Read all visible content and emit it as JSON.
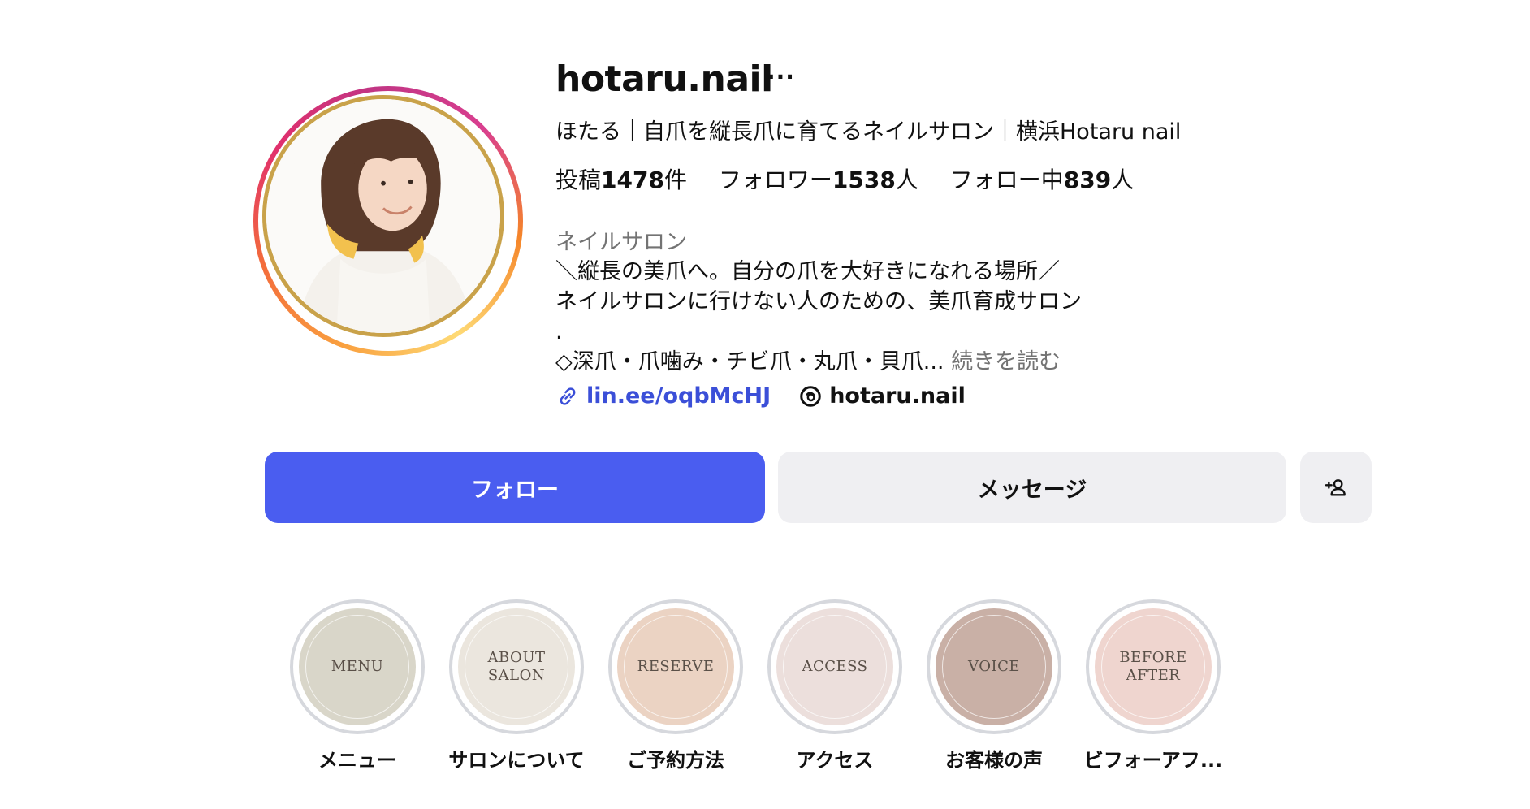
{
  "profile": {
    "username": "hotaru.nail",
    "more_label": "···",
    "full_name": "ほたる｜自爪を縦長爪に育てるネイルサロン｜横浜Hotaru nail",
    "avatar_icon": "profile-photo"
  },
  "stats": {
    "posts_prefix": "投稿",
    "posts_value": "1478",
    "posts_suffix": "件",
    "followers_prefix": "フォロワー",
    "followers_value": "1538",
    "followers_suffix": "人",
    "following_prefix": "フォロー中",
    "following_value": "839",
    "following_suffix": "人"
  },
  "category": "ネイルサロン",
  "bio": {
    "line1": "＼縦長の美爪へ。自分の爪を大好きになれる場所／",
    "line2": "ネイルサロンに行けない人のための、美爪育成サロン",
    "line3": ".",
    "line4": "◇深爪・爪噛み・チビ爪・丸爪・貝爪...",
    "read_more": "続きを読む"
  },
  "links": {
    "url_text": "lin.ee/oqbMcHJ",
    "url_icon": "link-icon",
    "threads_text": "hotaru.nail",
    "threads_icon": "threads-icon"
  },
  "buttons": {
    "follow": "フォロー",
    "message": "メッセージ",
    "add_user_icon": "add-user-icon"
  },
  "highlights": [
    {
      "cover": "MENU",
      "label": "メニュー",
      "color": "#d9d6c9"
    },
    {
      "cover": "ABOUT\nSALON",
      "label": "サロンについて",
      "color": "#ebe6de"
    },
    {
      "cover": "RESERVE",
      "label": "ご予約方法",
      "color": "#ebd3c3"
    },
    {
      "cover": "ACCESS",
      "label": "アクセス",
      "color": "#ecdfdc"
    },
    {
      "cover": "VOICE",
      "label": "お客様の声",
      "color": "#c9b0a6"
    },
    {
      "cover": "BEFORE\nAFTER",
      "label": "ビフォーアフ...",
      "color": "#efd5cf"
    }
  ],
  "colors": {
    "accent": "#4a5df0",
    "link": "#3b4fd8",
    "secondary_button": "#efeff2",
    "muted_text": "#737373"
  }
}
